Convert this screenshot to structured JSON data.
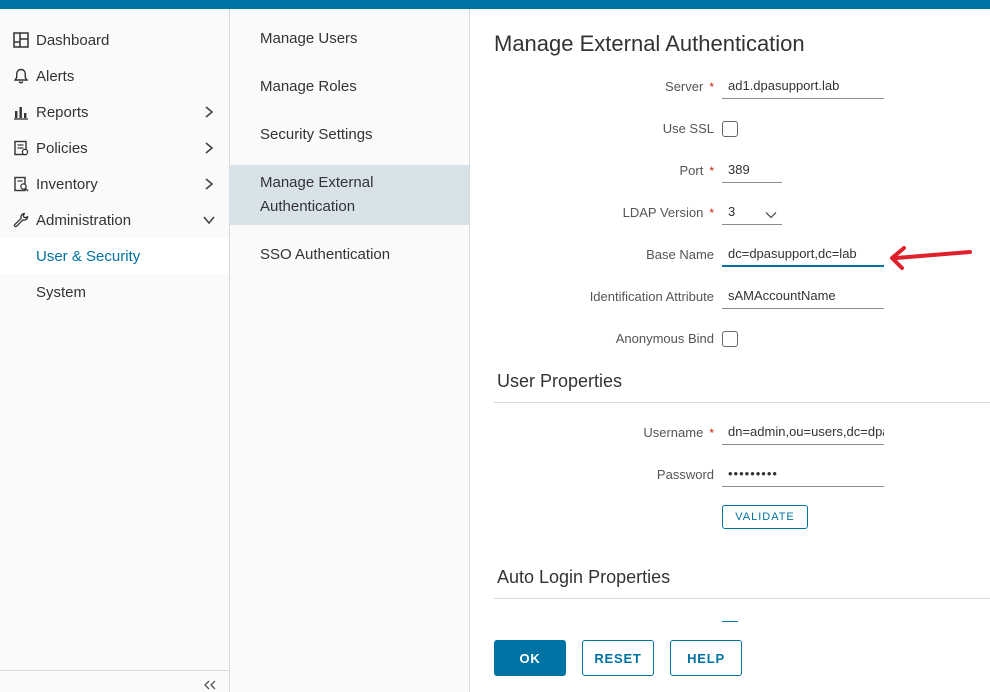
{
  "colors": {
    "accent": "#0072a3",
    "required": "#c92100",
    "annotation": "#e0202a"
  },
  "leftnav": {
    "items": [
      {
        "label": "Dashboard",
        "icon": "dashboard-icon"
      },
      {
        "label": "Alerts",
        "icon": "bell-icon"
      },
      {
        "label": "Reports",
        "icon": "bar-chart-icon"
      },
      {
        "label": "Policies",
        "icon": "policy-icon"
      },
      {
        "label": "Inventory",
        "icon": "inventory-icon"
      },
      {
        "label": "Administration",
        "icon": "wrench-icon"
      }
    ],
    "subitems": [
      {
        "label": "User & Security",
        "active": true
      },
      {
        "label": "System"
      }
    ],
    "collapse_icon": "double-chevron-left-icon"
  },
  "midnav": {
    "items": [
      {
        "label": "Manage Users"
      },
      {
        "label": "Manage Roles"
      },
      {
        "label": "Security Settings"
      },
      {
        "label_line1": "Manage External",
        "label_line2": "Authentication",
        "active": true
      },
      {
        "label": "SSO Authentication"
      }
    ]
  },
  "main": {
    "title": "Manage External Authentication",
    "form": {
      "server_label": "Server",
      "server_value": "ad1.dpasupport.lab",
      "use_ssl_label": "Use SSL",
      "port_label": "Port",
      "port_value": "389",
      "ldap_version_label": "LDAP Version",
      "ldap_version_value": "3",
      "base_name_label": "Base Name",
      "base_name_value": "dc=dpasupport,dc=lab",
      "id_attr_label": "Identification Attribute",
      "id_attr_value": "sAMAccountName",
      "anon_bind_label": "Anonymous Bind",
      "required_mark": "*"
    },
    "user_properties": {
      "title": "User Properties",
      "username_label": "Username",
      "username_value": "dn=admin,ou=users,dc=dpasupport,dc=lab",
      "password_label": "Password",
      "password_value": "•••••••••",
      "validate_label": "VALIDATE"
    },
    "auto_login": {
      "title": "Auto Login Properties"
    },
    "buttons": {
      "ok": "OK",
      "reset": "RESET",
      "help": "HELP"
    }
  }
}
